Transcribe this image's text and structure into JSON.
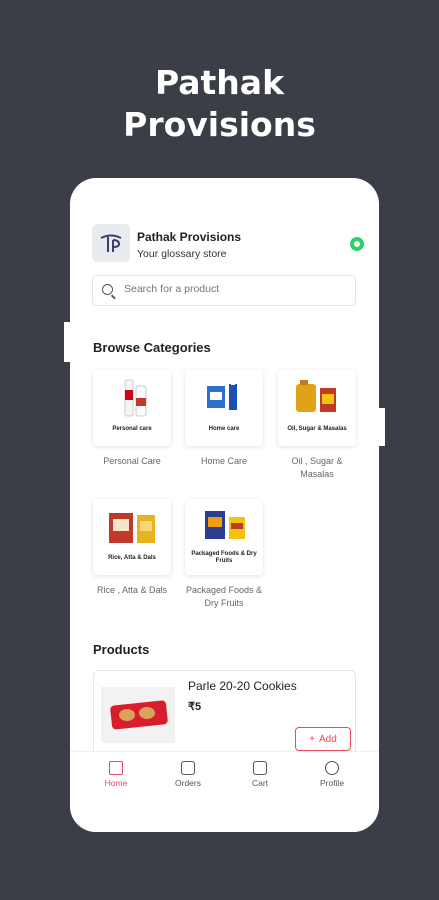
{
  "promo": {
    "title_line1": "Pathak",
    "title_line2": "Provisions"
  },
  "header": {
    "store_name": "Pathak Provisions",
    "tagline": "Your glossary store"
  },
  "search": {
    "placeholder": "Search for a product"
  },
  "sections": {
    "categories_title": "Browse Categories",
    "products_title": "Products"
  },
  "categories": [
    {
      "card_label": "Personal care",
      "name": "Personal Care"
    },
    {
      "card_label": "Home care",
      "name": "Home Care"
    },
    {
      "card_label": "Oil, Sugar & Masalas",
      "name_line1": "Oil , Sugar &",
      "name_line2": "Masalas"
    },
    {
      "card_label": "Rice, Atta & Dals",
      "name": "Rice , Atta & Dals"
    },
    {
      "card_label": "Packaged Foods & Dry Fruits",
      "name_line1": "Packaged Foods &",
      "name_line2": "Dry Fruits"
    }
  ],
  "products": [
    {
      "name": "Parle 20-20 Cookies",
      "price": "₹5",
      "add_label": "Add"
    }
  ],
  "nav": {
    "home": "Home",
    "orders": "Orders",
    "cart": "Cart",
    "profile": "Profile"
  },
  "colors": {
    "accent": "#e74c5c",
    "background": "#3b3e47",
    "whatsapp": "#25d366"
  }
}
